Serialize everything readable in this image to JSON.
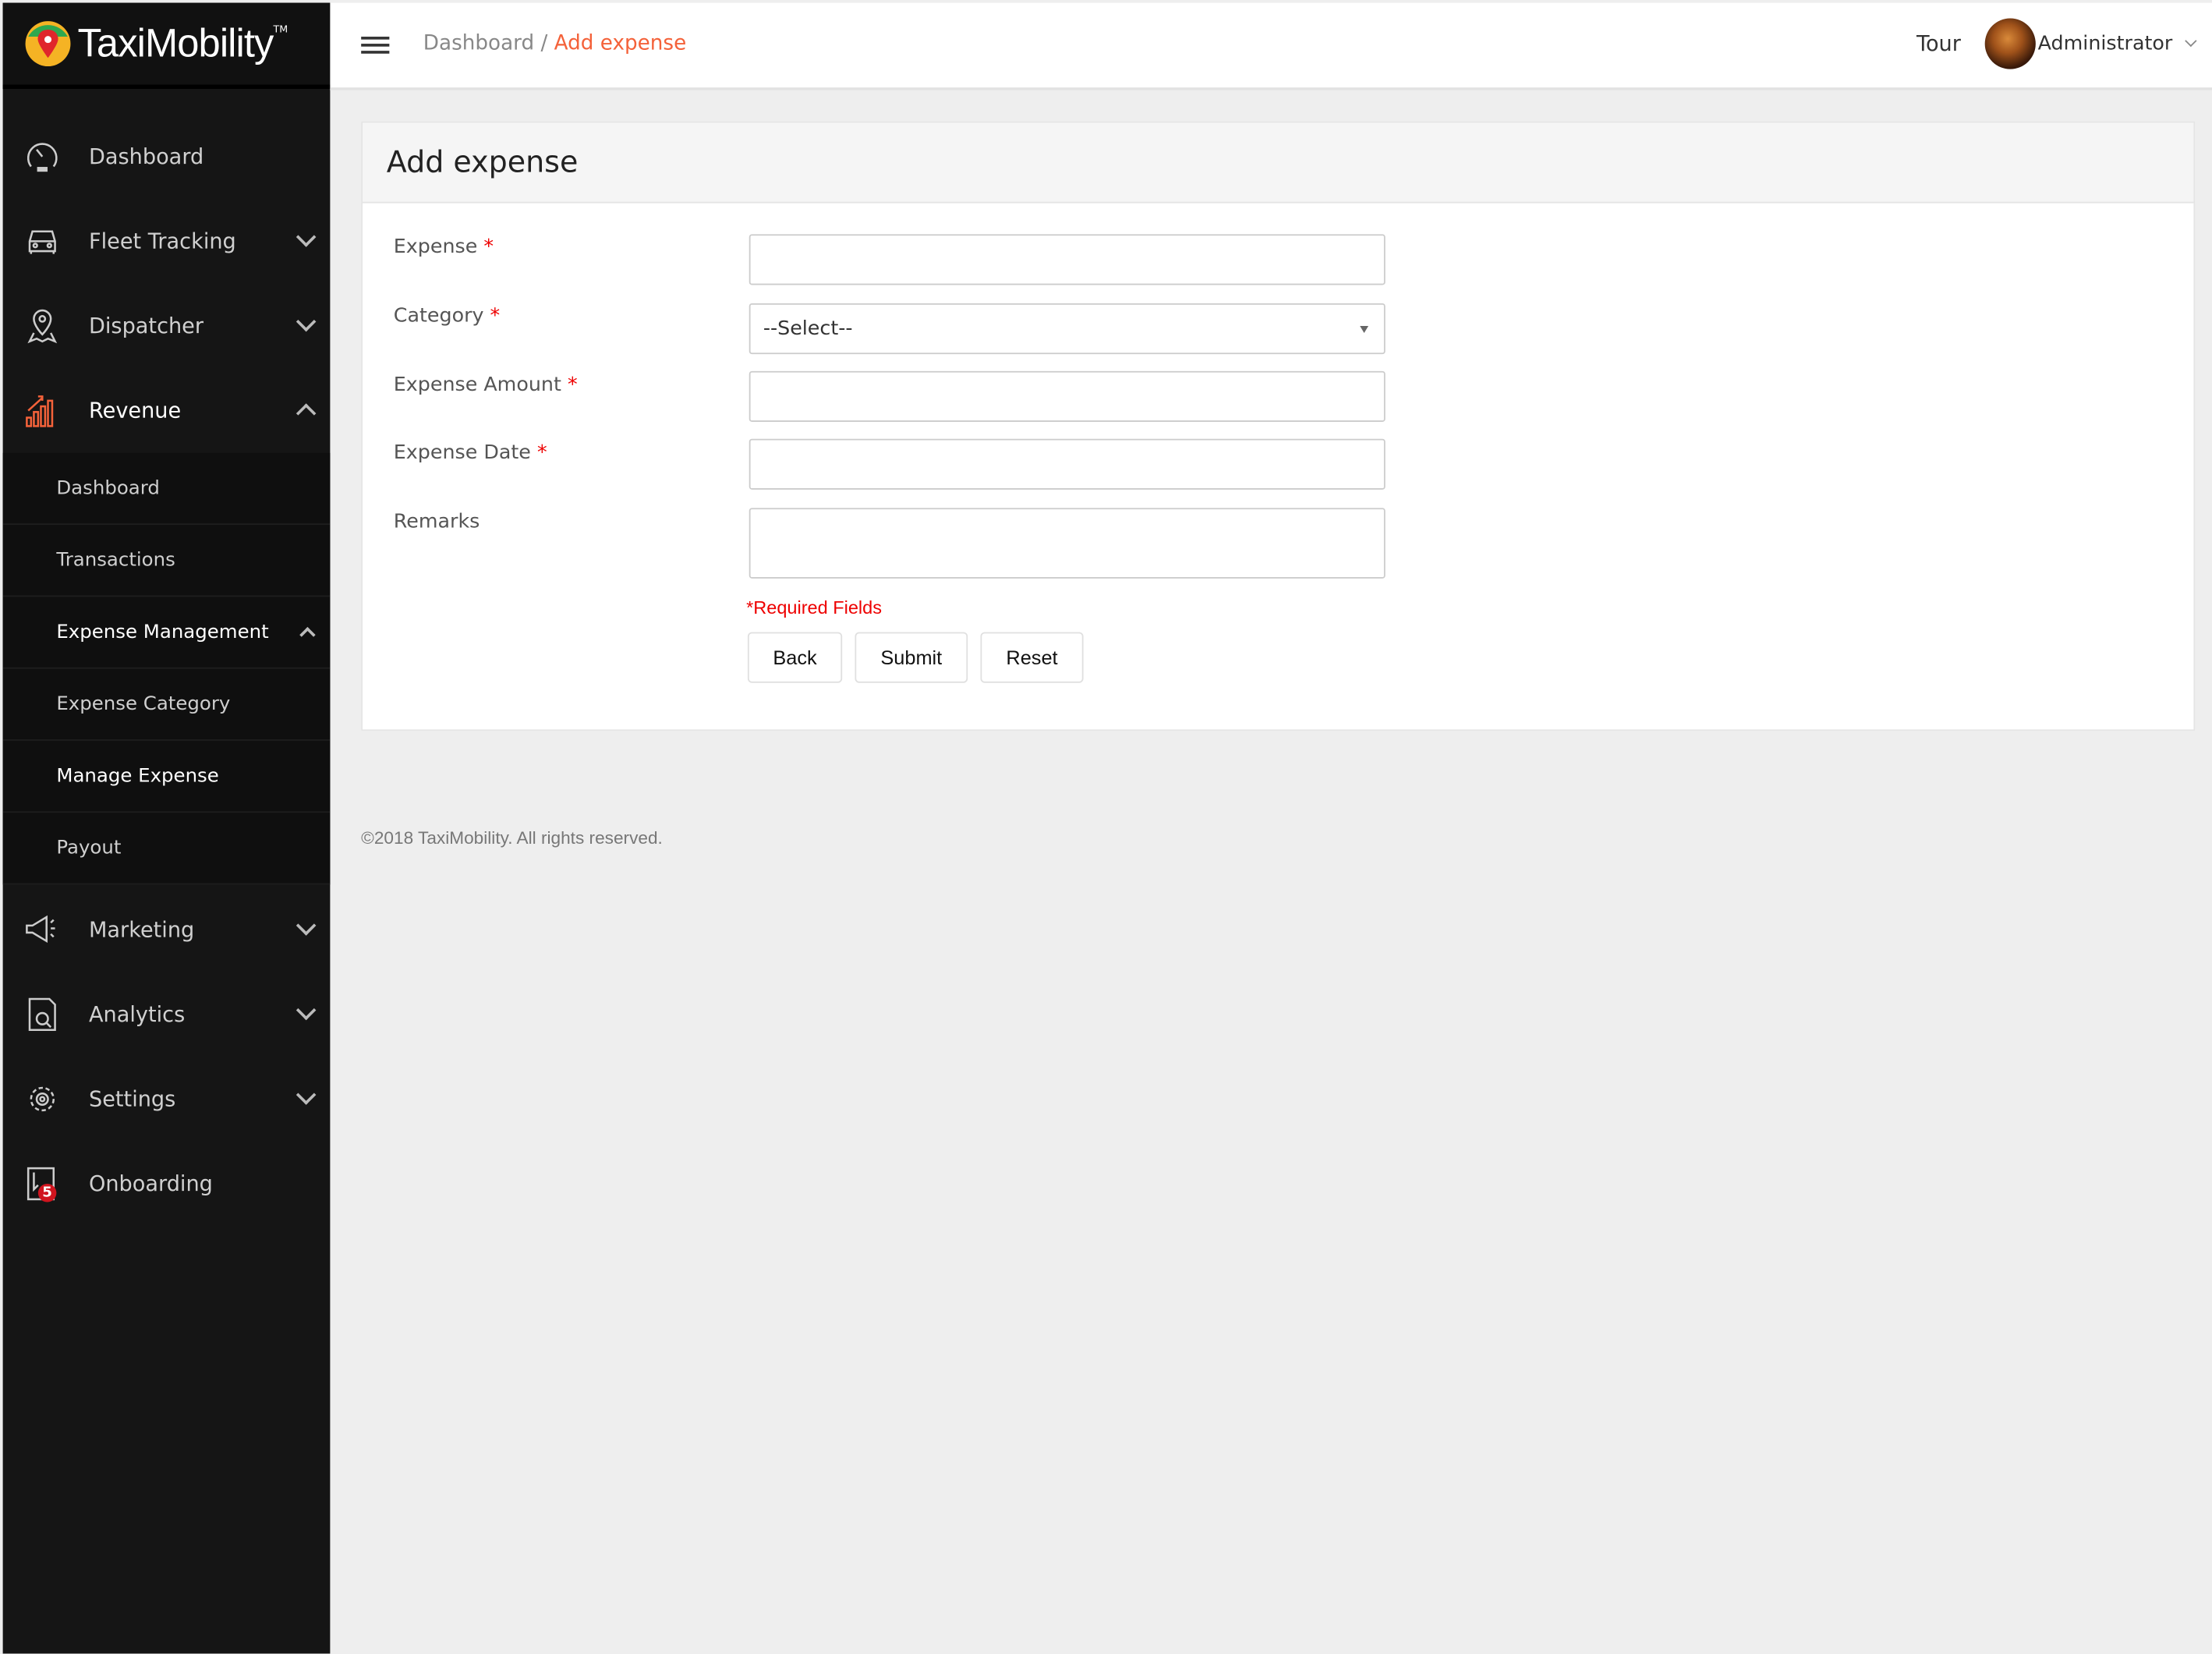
{
  "brand": {
    "name": "TaxiMobility",
    "tm": "TM"
  },
  "colors": {
    "accent": "#f4623a",
    "required": "#e00000",
    "sidebar": "#151515"
  },
  "header": {
    "breadcrumb": [
      {
        "label": "Dashboard"
      },
      {
        "label": "Add expense"
      }
    ],
    "separator": "/",
    "tour": "Tour",
    "user": "Administrator"
  },
  "sidebar": {
    "items": [
      {
        "label": "Dashboard",
        "icon": "speedometer-icon"
      },
      {
        "label": "Fleet Tracking",
        "icon": "car-icon"
      },
      {
        "label": "Dispatcher",
        "icon": "map-pin-icon"
      },
      {
        "label": "Revenue",
        "icon": "bar-chart-icon"
      },
      {
        "label": "Marketing",
        "icon": "megaphone-icon"
      },
      {
        "label": "Analytics",
        "icon": "document-search-icon"
      },
      {
        "label": "Settings",
        "icon": "gear-icon"
      },
      {
        "label": "Onboarding",
        "icon": "onboarding-icon",
        "badge": "5"
      }
    ],
    "revenue_sub": [
      {
        "label": "Dashboard"
      },
      {
        "label": "Transactions"
      },
      {
        "label": "Expense Management"
      },
      {
        "label": "Expense Category"
      },
      {
        "label": "Manage Expense"
      },
      {
        "label": "Payout"
      }
    ]
  },
  "form": {
    "title": "Add expense",
    "fields": [
      {
        "label": "Expense",
        "required": "*",
        "value": ""
      },
      {
        "label": "Category",
        "required": "*",
        "value": "--Select--"
      },
      {
        "label": "Expense Amount",
        "required": "*",
        "value": ""
      },
      {
        "label": "Expense Date",
        "required": "*",
        "value": ""
      },
      {
        "label": "Remarks",
        "value": ""
      }
    ],
    "required_note": "*Required Fields",
    "buttons": {
      "back": "Back",
      "submit": "Submit",
      "reset": "Reset"
    }
  },
  "footer": "©2018 TaxiMobility. All rights reserved."
}
